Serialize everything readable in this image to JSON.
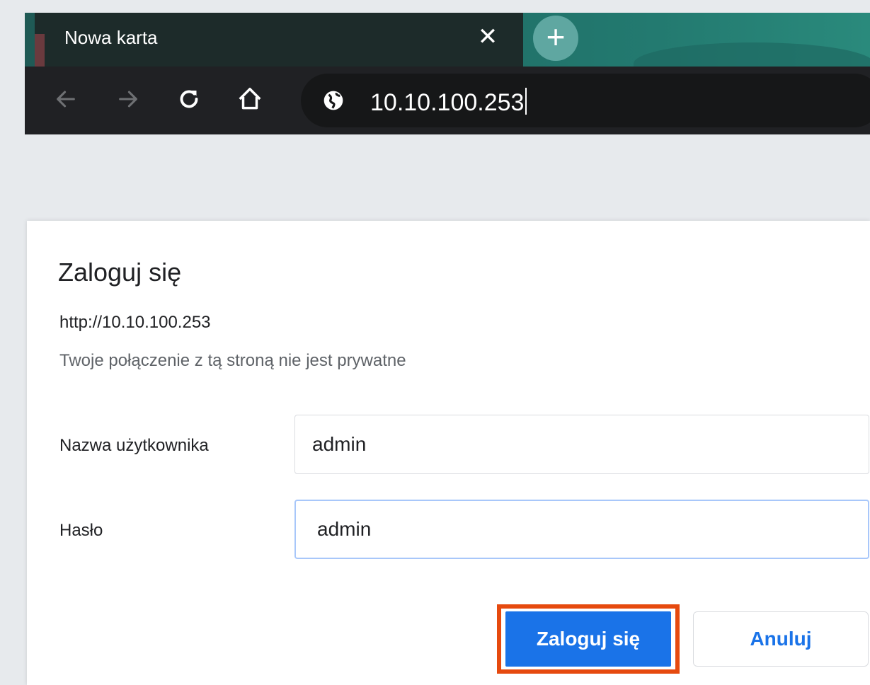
{
  "browser": {
    "tab_title": "Nowa karta",
    "close_glyph": "✕",
    "new_tab_glyph": "+",
    "address": "10.10.100.253",
    "icons": [
      "back-arrow-icon",
      "forward-arrow-icon",
      "reload-icon",
      "home-icon",
      "globe-icon"
    ]
  },
  "dialog": {
    "title": "Zaloguj się",
    "origin": "http://10.10.100.253",
    "warning": "Twoje połączenie z tą stroną nie jest prywatne",
    "username_label": "Nazwa użytkownika",
    "username_value": "admin",
    "password_label": "Hasło",
    "password_value": "admin",
    "login_button": "Zaloguj się",
    "cancel_button": "Anuluj"
  },
  "colors": {
    "primary_blue": "#1a73e8",
    "highlight_outline": "#e64a0f",
    "tab_strip": "#1f6b64",
    "toolbar": "#202124"
  }
}
